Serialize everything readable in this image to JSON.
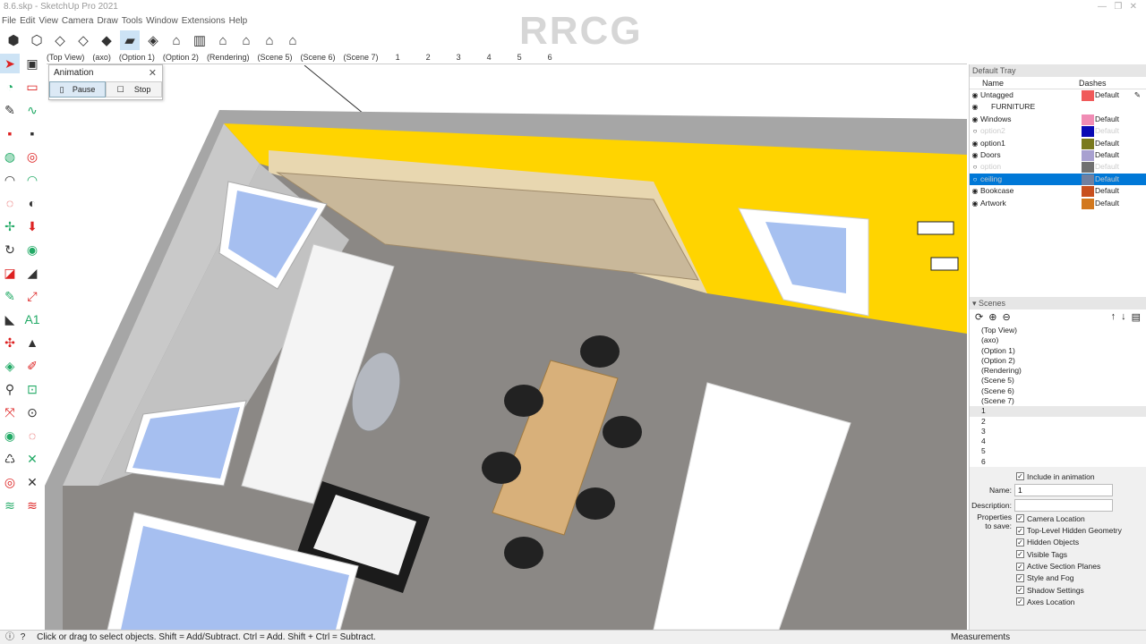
{
  "title": "8.6.skp - SketchUp Pro 2021",
  "watermark": "RRCG",
  "menu": [
    "File",
    "Edit",
    "View",
    "Camera",
    "Draw",
    "Tools",
    "Window",
    "Extensions",
    "Help"
  ],
  "toolbar_icons": [
    "xray-icon",
    "back-edges-icon",
    "wireframe-icon",
    "hidden-line-icon",
    "shaded-icon",
    "shaded-textures-icon",
    "monochrome-icon",
    "iso-view-icon",
    "top-view-icon",
    "front-view-icon",
    "right-view-icon",
    "back-view-icon",
    "left-view-icon"
  ],
  "scene_tabs": [
    "(Top View)",
    "(axo)",
    "(Option 1)",
    "(Option 2)",
    "(Rendering)",
    "(Scene 5)",
    "(Scene 6)",
    "(Scene 7)",
    "1",
    "2",
    "3",
    "4",
    "5",
    "6"
  ],
  "animation": {
    "title": "Animation",
    "pause": "Pause",
    "stop": "Stop"
  },
  "tray": {
    "title": "Default Tray",
    "tags_header": {
      "name": "Name",
      "dashes": "Dashes"
    },
    "tags": [
      {
        "name": "Untagged",
        "color": "#f05a5a",
        "dashes": "Default",
        "visible": true
      },
      {
        "name": "FURNITURE",
        "folder": true,
        "visible": true
      },
      {
        "name": "Windows",
        "color": "#f08cb4",
        "dashes": "Default",
        "visible": true
      },
      {
        "name": "option2",
        "color": "#0a0ab4",
        "dashes": "Default",
        "visible": false
      },
      {
        "name": "option1",
        "color": "#7a7a1e",
        "dashes": "Default",
        "visible": true
      },
      {
        "name": "Doors",
        "color": "#a8a0d0",
        "dashes": "Default",
        "visible": true
      },
      {
        "name": "option",
        "color": "#707070",
        "dashes": "Default",
        "visible": false
      },
      {
        "name": "ceiling",
        "color": "#7080a0",
        "dashes": "Default",
        "visible": false,
        "selected": true
      },
      {
        "name": "Bookcase",
        "color": "#c8501e",
        "dashes": "Default",
        "visible": true
      },
      {
        "name": "Artwork",
        "color": "#d2781e",
        "dashes": "Default",
        "visible": true
      }
    ],
    "scenes_title": "Scenes",
    "scenes": [
      "(Top View)",
      "(axo)",
      "(Option 1)",
      "(Option 2)",
      "(Rendering)",
      "(Scene 5)",
      "(Scene 6)",
      "(Scene 7)",
      "1",
      "2",
      "3",
      "4",
      "5",
      "6"
    ],
    "include_label": "Include in animation",
    "name_label": "Name:",
    "name_value": "1",
    "desc_label": "Description:",
    "desc_value": "",
    "props_label": "Properties to save:",
    "props": [
      "Camera Location",
      "Top-Level Hidden Geometry",
      "Hidden Objects",
      "Visible Tags",
      "Active Section Planes",
      "Style and Fog",
      "Shadow Settings",
      "Axes Location"
    ]
  },
  "status": {
    "text": "Click or drag to select objects. Shift = Add/Subtract. Ctrl = Add. Shift + Ctrl = Subtract.",
    "measurements": "Measurements"
  },
  "colors": {
    "wall": "#ffd400",
    "floor": "#8a8784",
    "selection": "#0078d7"
  }
}
